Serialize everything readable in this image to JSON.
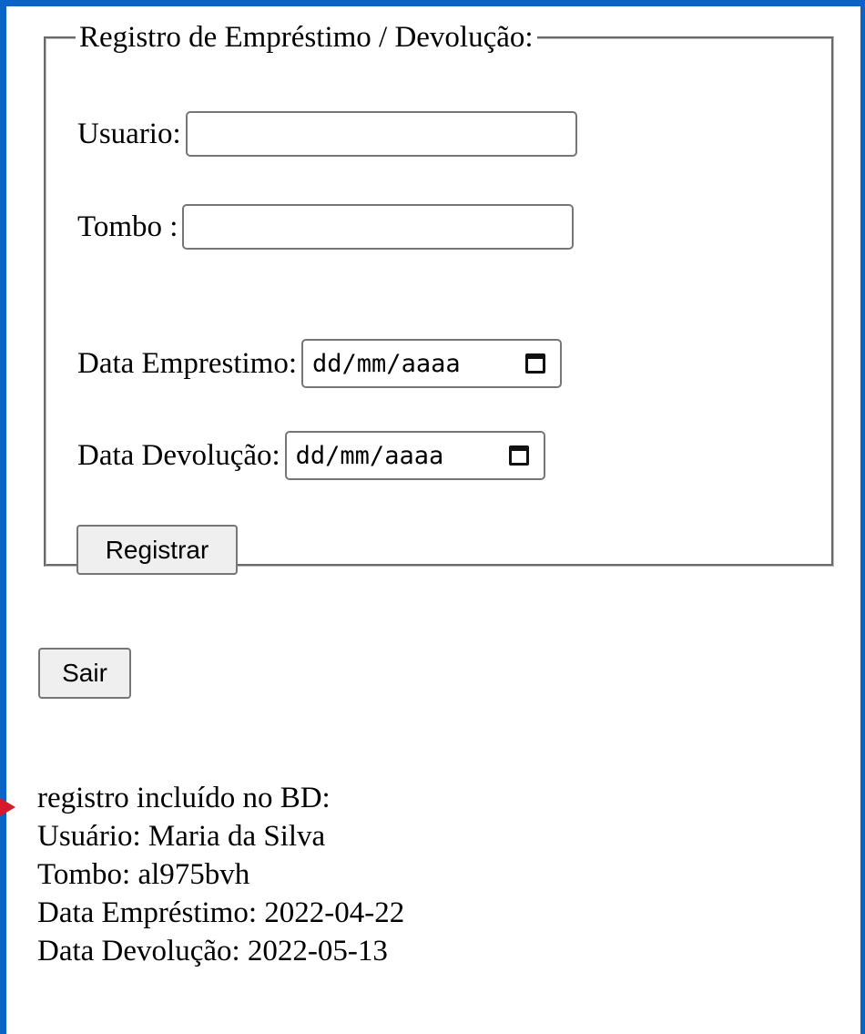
{
  "form": {
    "legend": "Registro de Empréstimo / Devolução:",
    "usuario_label": "Usuario:",
    "usuario_value": "",
    "tombo_label": "Tombo :",
    "tombo_value": "",
    "data_emprestimo_label": "Data Emprestimo:",
    "data_emprestimo_placeholder": "dd/mm/aaaa",
    "data_devolucao_label": "Data Devolução:",
    "data_devolucao_placeholder": "dd/mm/aaaa",
    "registrar_label": "Registrar"
  },
  "actions": {
    "sair_label": "Sair"
  },
  "result": {
    "heading": "registro incluído no BD:",
    "usuario_line": "Usuário: Maria da Silva",
    "tombo_line": "Tombo: al975bvh",
    "emprestimo_line": "Data Empréstimo: 2022-04-22",
    "devolucao_line": "Data Devolução: 2022-05-13"
  },
  "icons": {
    "date_picker": "calendar-icon",
    "marker": "red-arrow-marker"
  },
  "colors": {
    "frame": "#0a63c6",
    "marker": "#d7192b",
    "button_bg": "#efefef",
    "input_border": "#767676"
  }
}
